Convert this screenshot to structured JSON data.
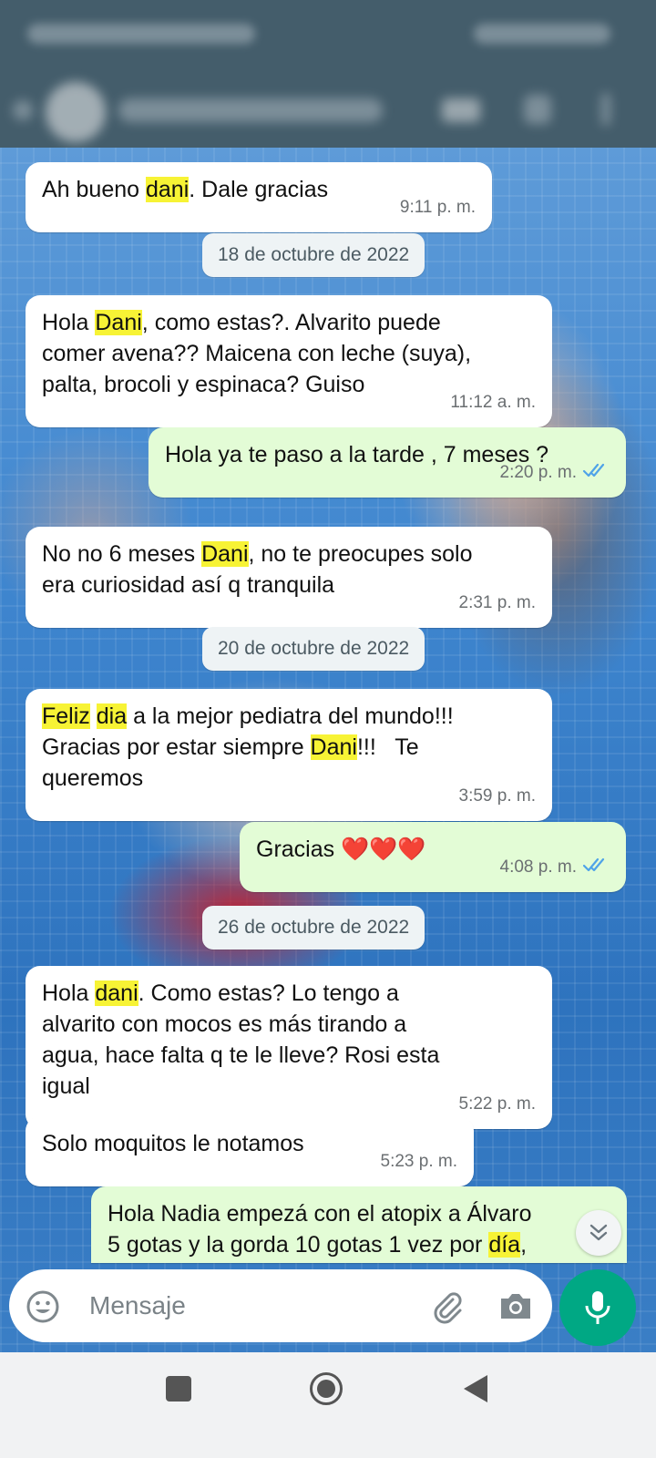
{
  "input": {
    "placeholder": "Mensaje"
  },
  "messages": [
    {
      "dir": "in",
      "parts": [
        {
          "t": "Ah bueno "
        },
        {
          "t": "dani",
          "hl": true
        },
        {
          "t": ". Dale gracias"
        }
      ],
      "time": "9:11 p. m."
    },
    {
      "date": "18 de octubre de 2022"
    },
    {
      "dir": "in",
      "parts": [
        {
          "t": "Hola "
        },
        {
          "t": "Dani",
          "hl": true
        },
        {
          "t": ", como estas?. Alvarito puede\ncomer avena?? Maicena con leche (suya),\npalta, brocoli y espinaca? Guiso"
        }
      ],
      "time": "11:12 a. m."
    },
    {
      "dir": "out",
      "parts": [
        {
          "t": "Hola ya te paso a la tarde , 7 meses ?"
        }
      ],
      "time": "2:20 p. m.",
      "read": true
    },
    {
      "dir": "in",
      "parts": [
        {
          "t": "No no 6 meses "
        },
        {
          "t": "Dani",
          "hl": true
        },
        {
          "t": ", no te preocupes solo\nera curiosidad así q tranquila"
        }
      ],
      "time": "2:31 p. m."
    },
    {
      "date": "20 de octubre de 2022"
    },
    {
      "dir": "in",
      "parts": [
        {
          "t": "Feliz",
          "hl": true
        },
        {
          "t": " "
        },
        {
          "t": "dia",
          "hl": true
        },
        {
          "t": " a la mejor pediatra del mundo!!!\nGracias por estar siempre "
        },
        {
          "t": "Dani",
          "hl": true
        },
        {
          "t": "!!!   Te\nqueremos"
        }
      ],
      "time": "3:59 p. m."
    },
    {
      "dir": "out",
      "parts": [
        {
          "t": "Gracias ❤️❤️❤️"
        }
      ],
      "time": "4:08 p. m.",
      "read": true
    },
    {
      "date": "26 de octubre de 2022"
    },
    {
      "dir": "in",
      "parts": [
        {
          "t": "Hola "
        },
        {
          "t": "dani",
          "hl": true
        },
        {
          "t": ". Como estas? Lo tengo a\nalvarito con mocos es más tirando a\nagua, hace falta q te le lleve? Rosi esta\nigual"
        }
      ],
      "time": "5:22 p. m."
    },
    {
      "dir": "in",
      "parts": [
        {
          "t": "Solo moquitos le notamos"
        }
      ],
      "time": "5:23 p. m."
    },
    {
      "dir": "out",
      "parts": [
        {
          "t": "Hola Nadia empezá con el atopix a Álvaro\n5 gotas y la gorda 10 gotas 1 vez por "
        },
        {
          "t": "día",
          "hl": true
        },
        {
          "t": ","
        }
      ],
      "time": "",
      "read": false
    }
  ],
  "colors": {
    "header": "#445d6b",
    "outgoing_bubble": "#e3fcd6",
    "incoming_bubble": "#ffffff",
    "highlight": "#f7f335",
    "accent": "#00a884",
    "read_ticks": "#4fa3e8"
  }
}
